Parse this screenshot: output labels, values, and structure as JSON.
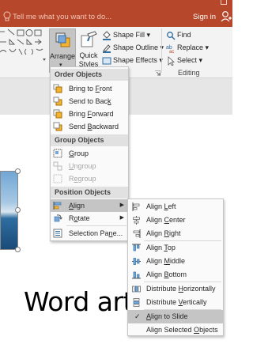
{
  "titlebar": {
    "tell_me": "Tell me what you want to do...",
    "sign_in": "Sign in"
  },
  "ribbon": {
    "arrange_label": "Arrange",
    "quick_styles_label": "Quick Styles",
    "quick_styles_line1": "Quick",
    "quick_styles_line2": "Styles",
    "shape_fill": "Shape Fill",
    "shape_outline": "Shape Outline",
    "shape_effects": "Shape Effects",
    "find": "Find",
    "replace": "Replace",
    "select": "Select",
    "editing_group": "Editing"
  },
  "arrange_menu": {
    "headers": {
      "order": "Order Objects",
      "group": "Group Objects",
      "position": "Position Objects"
    },
    "order_items": [
      {
        "pre": "Bring to ",
        "key": "F",
        "post": "ront"
      },
      {
        "pre": "Send to Bac",
        "key": "k",
        "post": ""
      },
      {
        "pre": "Bring ",
        "key": "F",
        "post": "orward"
      },
      {
        "pre": "Send ",
        "key": "B",
        "post": "ackward"
      }
    ],
    "group_items": [
      {
        "pre": "",
        "key": "G",
        "post": "roup"
      },
      {
        "pre": "",
        "key": "U",
        "post": "ngroup"
      },
      {
        "pre": "R",
        "key": "e",
        "post": "group"
      }
    ],
    "position_items": [
      {
        "pre": "",
        "key": "A",
        "post": "lign"
      },
      {
        "pre": "R",
        "key": "o",
        "post": "tate"
      },
      {
        "pre": "Selection Pa",
        "key": "n",
        "post": "e..."
      }
    ]
  },
  "align_submenu": {
    "items": [
      {
        "pre": "Align ",
        "key": "L",
        "post": "eft"
      },
      {
        "pre": "Align ",
        "key": "C",
        "post": "enter"
      },
      {
        "pre": "Align ",
        "key": "R",
        "post": "ight"
      },
      {
        "pre": "Align ",
        "key": "T",
        "post": "op"
      },
      {
        "pre": "Align ",
        "key": "M",
        "post": "iddle"
      },
      {
        "pre": "Align ",
        "key": "B",
        "post": "ottom"
      },
      {
        "pre": "Distribute ",
        "key": "H",
        "post": "orizontally"
      },
      {
        "pre": "Distribute ",
        "key": "V",
        "post": "ertically"
      },
      {
        "pre": "",
        "key": "A",
        "post": "lign to Slide"
      },
      {
        "pre": "Align Selected ",
        "key": "O",
        "post": "bjects"
      }
    ]
  },
  "slide": {
    "wordart_text": "Word art"
  },
  "colors": {
    "accent": "#b7472a",
    "menu_highlight": "#c5c5c5"
  }
}
